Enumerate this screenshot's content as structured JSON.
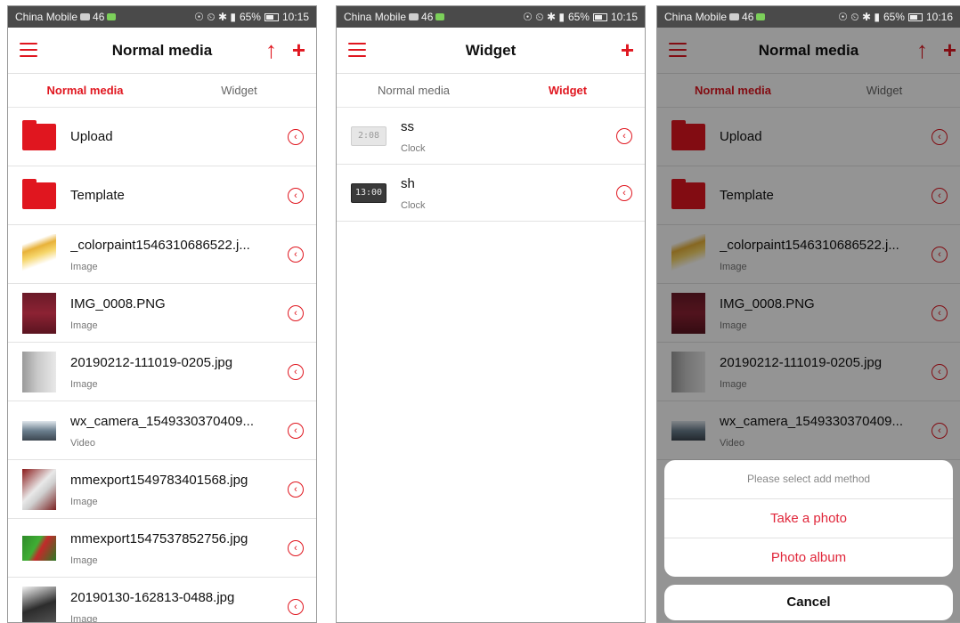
{
  "statusbar": {
    "carrier": "China Mobile",
    "signal": "46",
    "icons_right": "☉ ⏲ ✱ ▮",
    "battery": "65%",
    "time_1": "10:15",
    "time_2": "10:15",
    "time_3": "10:16"
  },
  "screen1": {
    "title": "Normal media",
    "tabs": [
      "Normal media",
      "Widget"
    ],
    "folders": [
      {
        "label": "Upload"
      },
      {
        "label": "Template"
      }
    ],
    "files": [
      {
        "name": "_colorpaint1546310686522.j...",
        "type": "Image"
      },
      {
        "name": "IMG_0008.PNG",
        "type": "Image"
      },
      {
        "name": "20190212-111019-0205.jpg",
        "type": "Image"
      },
      {
        "name": "wx_camera_1549330370409...",
        "type": "Video"
      },
      {
        "name": "mmexport1549783401568.jpg",
        "type": "Image"
      },
      {
        "name": "mmexport1547537852756.jpg",
        "type": "Image"
      },
      {
        "name": "20190130-162813-0488.jpg",
        "type": "Image"
      }
    ]
  },
  "screen2": {
    "title": "Widget",
    "tabs": [
      "Normal media",
      "Widget"
    ],
    "widgets": [
      {
        "name": "ss",
        "type": "Clock",
        "thumb_text": "2:08"
      },
      {
        "name": "sh",
        "type": "Clock",
        "thumb_text": "13:00"
      }
    ]
  },
  "screen3": {
    "title": "Normal media",
    "tabs": [
      "Normal media",
      "Widget"
    ],
    "sheet": {
      "title": "Please select add method",
      "options": [
        "Take a photo",
        "Photo album"
      ],
      "cancel": "Cancel"
    }
  },
  "colors": {
    "accent": "#e0161f",
    "sheet_option": "#e0263a"
  },
  "icons": {
    "menu": "hamburger-icon",
    "upload": "arrow-up-icon",
    "add": "plus-icon",
    "row_action": "chevron-left-circle-icon",
    "folder": "folder-icon"
  }
}
